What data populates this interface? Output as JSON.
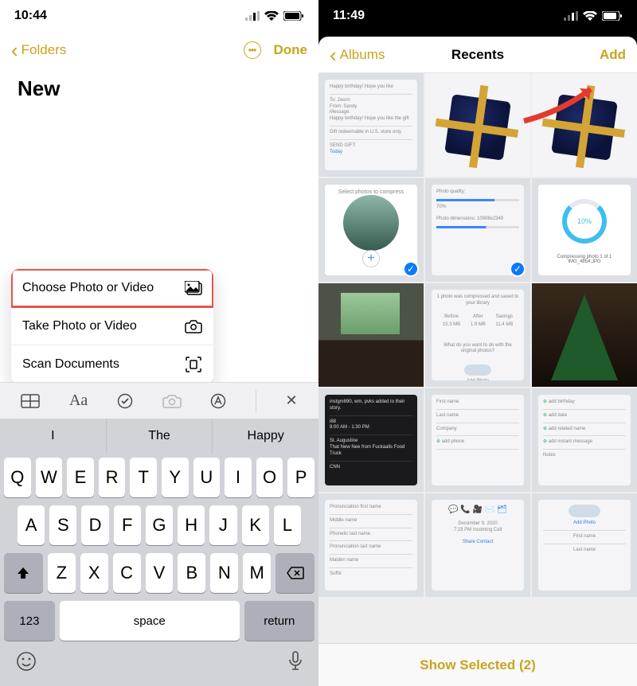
{
  "left": {
    "status_time": "10:44",
    "nav": {
      "back": "Folders",
      "done": "Done"
    },
    "note_title": "New",
    "menu": {
      "choose": "Choose Photo or Video",
      "take": "Take Photo or Video",
      "scan": "Scan Documents"
    },
    "strip": {
      "aa": "Aa",
      "close": "✕"
    },
    "predict": {
      "p1": "I",
      "p2": "The",
      "p3": "Happy"
    },
    "keys": {
      "r1": [
        "Q",
        "W",
        "E",
        "R",
        "T",
        "Y",
        "U",
        "I",
        "O",
        "P"
      ],
      "r2": [
        "A",
        "S",
        "D",
        "F",
        "G",
        "H",
        "J",
        "K",
        "L"
      ],
      "r3": [
        "Z",
        "X",
        "C",
        "V",
        "B",
        "N",
        "M"
      ],
      "num": "123",
      "space": "space",
      "return": "return"
    }
  },
  "right": {
    "status_time": "11:49",
    "nav": {
      "back": "Albums",
      "title": "Recents",
      "add": "Add"
    },
    "footer": "Show Selected (2)",
    "selected_count": 2
  }
}
